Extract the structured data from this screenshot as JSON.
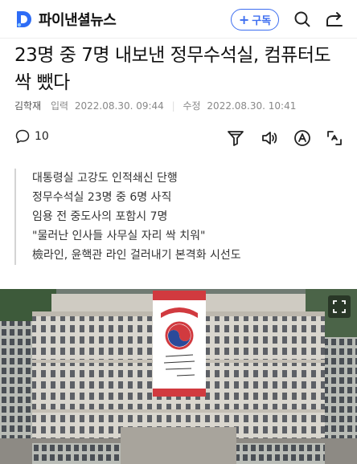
{
  "header": {
    "press_name": "파이낸셜뉴스",
    "subscribe_label": "구독",
    "subscribe_plus": "+"
  },
  "article": {
    "title": "23명 중 7명 내보낸 정무수석실, 컴퓨터도 싹 뺐다",
    "author": "김학재",
    "input_label": "입력",
    "input_time": "2022.08.30. 09:44",
    "modify_label": "수정",
    "modify_time": "2022.08.30. 10:41",
    "comment_count": "10",
    "summary": [
      "대통령실 고강도 인적쇄신 단행",
      "정무수석실 23명 중 6명 사직",
      "임용 전 중도사의 포함시 7명",
      "\"물러난 인사들 사무실 자리 싹 치워\"",
      "檢라인, 윤핵관 라인 걸러내기 본격화 시선도"
    ]
  },
  "colors": {
    "accent": "#3c6df0",
    "logo": "#2e6cf6"
  }
}
